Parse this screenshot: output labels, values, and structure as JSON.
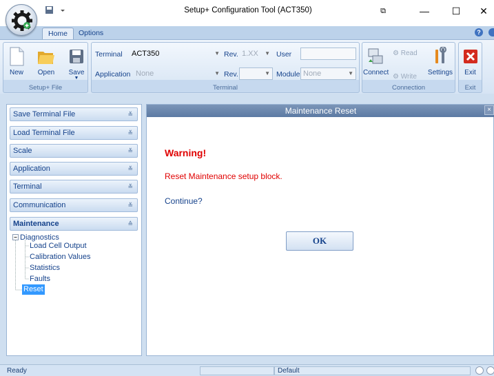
{
  "window": {
    "title": "Setup+ Configuration Tool (ACT350)",
    "controls": {
      "minimize": "—",
      "maximize": "☐",
      "close": "✕"
    }
  },
  "tabs": {
    "home": "Home",
    "options": "Options"
  },
  "ribbon": {
    "file_group": {
      "new": "New",
      "open": "Open",
      "save": "Save",
      "caption": "Setup+ File"
    },
    "terminal_group": {
      "terminal_label": "Terminal",
      "terminal_value": "ACT350",
      "rev_label": "Rev.",
      "rev_value": "1.XX",
      "user_label": "User",
      "user_value": "",
      "application_label": "Application",
      "application_value": "None",
      "rev2_label": "Rev.",
      "rev2_value": "",
      "module_label": "Module",
      "module_value": "None",
      "caption": "Terminal"
    },
    "connection_group": {
      "connect": "Connect",
      "read": "Read",
      "write": "Write",
      "settings": "Settings",
      "caption": "Connection"
    },
    "exit_group": {
      "exit": "Exit",
      "caption": "Exit"
    }
  },
  "sidebar": {
    "sections": [
      "Save Terminal File",
      "Load Terminal File",
      "Scale",
      "Application",
      "Terminal",
      "Communication"
    ],
    "maintenance": {
      "label": "Maintenance",
      "diagnostics": "Diagnostics",
      "children": [
        "Load Cell Output",
        "Calibration Values",
        "Statistics",
        "Faults"
      ],
      "reset": "Reset"
    }
  },
  "dialog": {
    "title": "Maintenance Reset",
    "warning": "Warning!",
    "message": "Reset Maintenance setup block.",
    "prompt": "Continue?",
    "ok": "OK",
    "close": "×"
  },
  "status": {
    "left": "Ready",
    "middle": "Default"
  },
  "colors": {
    "warning": "#e00000",
    "selection": "#3399ff",
    "accent": "#15428b"
  }
}
